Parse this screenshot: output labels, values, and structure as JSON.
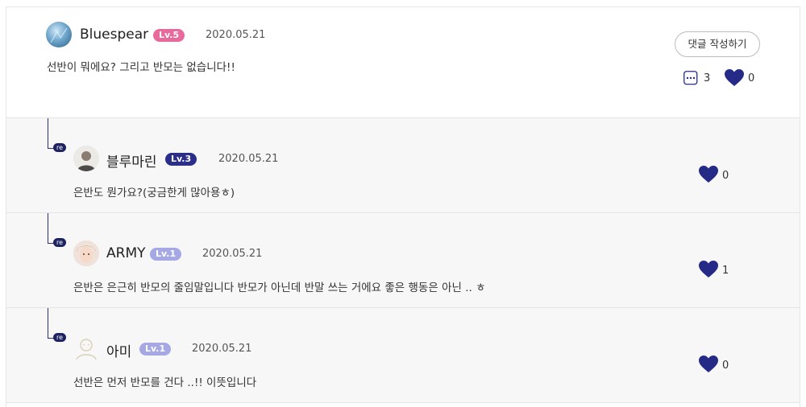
{
  "main_comment": {
    "username": "Bluespear",
    "level": "Lv.5",
    "date": "2020.05.21",
    "text": "선반이 뭐에요? 그리고 반모는 없습니다!!",
    "write_reply_label": "댓글 작성하기",
    "reply_count": "3",
    "like_count": "0",
    "level_color": "#e86a9c"
  },
  "replies": [
    {
      "re_tag": "re",
      "username": "블루마린",
      "level": "Lv.3",
      "level_color": "#2b2f8a",
      "date": "2020.05.21",
      "text": "은반도 뭔가요?(궁금한게 많아용ㅎ)",
      "like_count": "0"
    },
    {
      "re_tag": "re",
      "username": "ARMY",
      "level": "Lv.1",
      "level_color": "#a6a8e6",
      "date": "2020.05.21",
      "text": "은반은 은근히 반모의 줄임말입니다 반모가 아닌데 반말 쓰는 거에요 좋은 행동은 아닌 .. ㅎ",
      "like_count": "1"
    },
    {
      "re_tag": "re",
      "username": "아미",
      "level": "Lv.1",
      "level_color": "#a6a8e6",
      "date": "2020.05.21",
      "text": "선반은 먼저 반모를 건다 ..!! 이뜻입니다",
      "like_count": "0"
    }
  ],
  "colors": {
    "heart": "#252a86",
    "branch": "#2b2f7a"
  },
  "icons": [
    "heart-icon",
    "comment-bubble-icon",
    "default-avatar-icon"
  ]
}
